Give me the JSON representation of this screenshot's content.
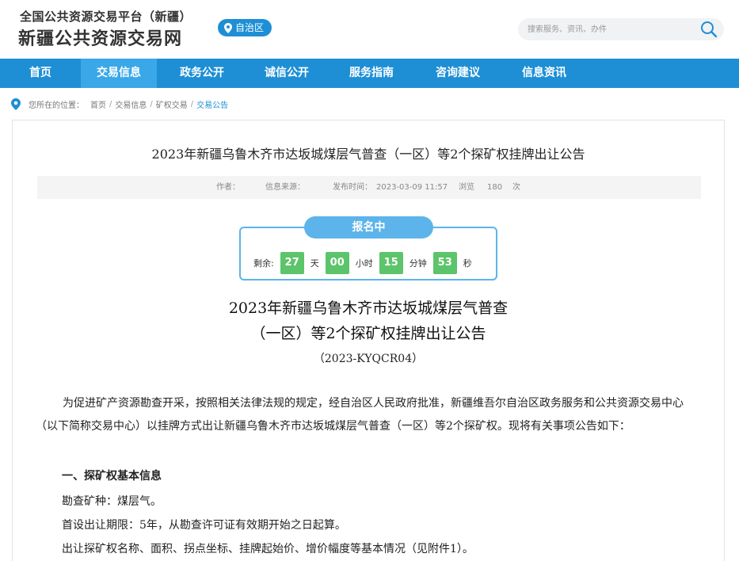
{
  "header": {
    "logo_top": "全国公共资源交易平台（新疆）",
    "logo_main": "新疆公共资源交易网",
    "region_badge": "自治区",
    "search_placeholder": "搜索服务、资讯、办件"
  },
  "nav": {
    "items": [
      {
        "label": "首页"
      },
      {
        "label": "交易信息"
      },
      {
        "label": "政务公开"
      },
      {
        "label": "诚信公开"
      },
      {
        "label": "服务指南"
      },
      {
        "label": "咨询建议"
      },
      {
        "label": "信息资讯"
      }
    ],
    "active_index": 1
  },
  "breadcrumb": {
    "prefix": "您所在的位置：",
    "items": [
      "首页",
      "交易信息",
      "矿权交易",
      "交易公告"
    ],
    "separator": "/"
  },
  "article": {
    "title": "2023年新疆乌鲁木齐市达坂城煤层气普查（一区）等2个探矿权挂牌出让公告",
    "meta": {
      "author_label": "作者：",
      "source_label": "信息来源：",
      "publish_label": "发布时间：",
      "publish_time": "2023-03-09 11:57",
      "views_label": "浏览",
      "views_count": "180",
      "views_unit": "次"
    }
  },
  "countdown": {
    "status": "报名中",
    "remaining_label": "剩余:",
    "days": "27",
    "days_unit": "天",
    "hours": "00",
    "hours_unit": "小时",
    "minutes": "15",
    "minutes_unit": "分钟",
    "seconds": "53",
    "seconds_unit": "秒"
  },
  "document": {
    "title_line1": "2023年新疆乌鲁木齐市达坂城煤层气普查",
    "title_line2": "（一区）等2个探矿权挂牌出让公告",
    "code": "（2023-KYQCR04）",
    "intro": "为促进矿产资源勘查开采，按照相关法律法规的规定，经自治区人民政府批准，新疆维吾尔自治区政务服务和公共资源交易中心（以下简称交易中心）以挂牌方式出让新疆乌鲁木齐市达坂城煤层气普查（一区）等2个探矿权。现将有关事项公告如下：",
    "section1_heading": "一、探矿权基本信息",
    "mineral": "勘查矿种：煤层气。",
    "term": "首设出让期限：5年，从勘查许可证有效期开始之日起算。",
    "details": "出让探矿权名称、面积、拐点坐标、挂牌起始价、增价幅度等基本情况（见附件1）。"
  },
  "colors": {
    "brand_blue": "#1e8fd5",
    "nav_active": "#3aa7e8",
    "countdown_border": "#5db4ea",
    "countdown_number": "#5cc46a"
  }
}
